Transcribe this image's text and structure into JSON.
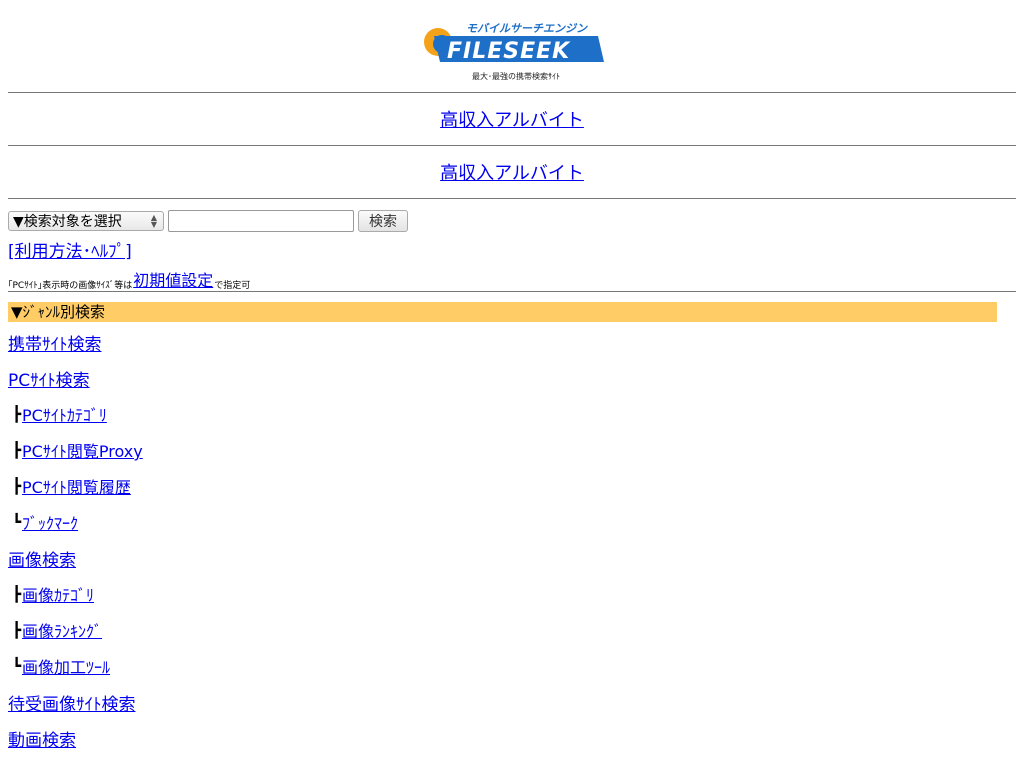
{
  "logo": {
    "katakana": "モバイルサーチエンジン",
    "brand": "FILESEEK",
    "tagline": "最大･最強の携帯検索ｻｲﾄ"
  },
  "ads": [
    {
      "label": "高収入アルバイト"
    },
    {
      "label": "高収入アルバイト"
    }
  ],
  "search": {
    "select_value": "▼検索対象を選択",
    "input_value": "",
    "button_label": "検索"
  },
  "help_link": "[利用方法･ﾍﾙﾌﾟ]",
  "note": {
    "prefix": "｢PCｻｲﾄ｣表示時の画像ｻｲｽﾞ等は",
    "link": "初期値設定",
    "suffix": "で指定可"
  },
  "genre": {
    "heading": "▼ｼﾞｬﾝﾙ別検索",
    "items": [
      {
        "branch": "",
        "label": "携帯ｻｲﾄ検索"
      },
      {
        "branch": "",
        "label": "PCｻｲﾄ検索"
      },
      {
        "branch": "┣",
        "label": "PCｻｲﾄｶﾃｺﾞﾘ"
      },
      {
        "branch": "┣",
        "label": "PCｻｲﾄ閲覧Proxy"
      },
      {
        "branch": "┣",
        "label": "PCｻｲﾄ閲覧履歴"
      },
      {
        "branch": "┗",
        "label": "ﾌﾞｯｸﾏｰｸ"
      },
      {
        "branch": "",
        "label": "画像検索"
      },
      {
        "branch": "┣",
        "label": "画像ｶﾃｺﾞﾘ"
      },
      {
        "branch": "┣",
        "label": "画像ﾗﾝｷﾝｸﾞ"
      },
      {
        "branch": "┗",
        "label": "画像加工ﾂｰﾙ"
      },
      {
        "branch": "",
        "label": "待受画像ｻｲﾄ検索"
      },
      {
        "branch": "",
        "label": "動画検索"
      }
    ]
  },
  "colors": {
    "link": "#0000ee",
    "genre_header_bg": "#ffcc66",
    "logo_blue": "#1e6fc8",
    "logo_orange": "#f5a21b"
  }
}
